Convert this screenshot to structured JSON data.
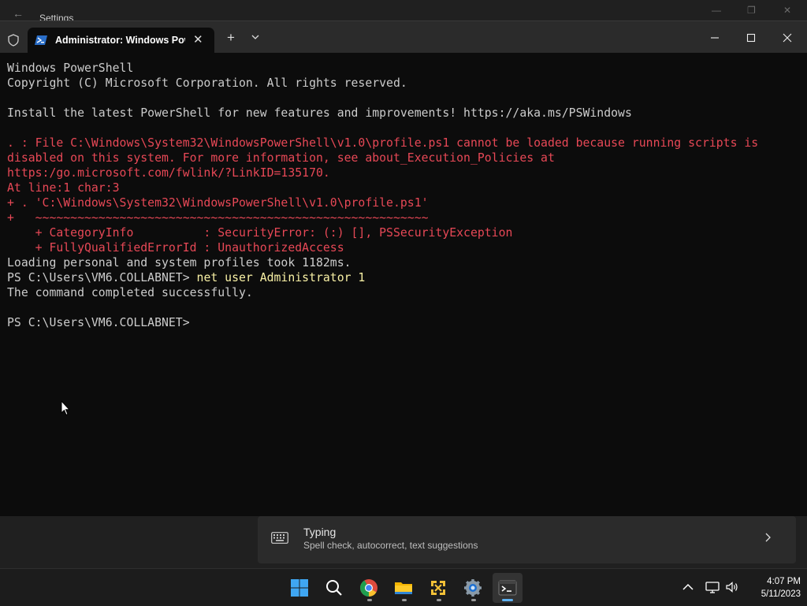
{
  "background_window": {
    "title": "Settings"
  },
  "terminal": {
    "tab_title": "Administrator: Windows PowerShell",
    "lines": [
      {
        "text": "Windows PowerShell",
        "color": "default"
      },
      {
        "text": "Copyright (C) Microsoft Corporation. All rights reserved.",
        "color": "default"
      },
      {
        "text": "",
        "color": "default"
      },
      {
        "text": "Install the latest PowerShell for new features and improvements! https://aka.ms/PSWindows",
        "color": "default"
      },
      {
        "text": "",
        "color": "default"
      },
      {
        "text": ". : File C:\\Windows\\System32\\WindowsPowerShell\\v1.0\\profile.ps1 cannot be loaded because running scripts is",
        "color": "red"
      },
      {
        "text": "disabled on this system. For more information, see about_Execution_Policies at",
        "color": "red"
      },
      {
        "text": "https:/go.microsoft.com/fwlink/?LinkID=135170.",
        "color": "red"
      },
      {
        "text": "At line:1 char:3",
        "color": "red"
      },
      {
        "text": "+ . 'C:\\Windows\\System32\\WindowsPowerShell\\v1.0\\profile.ps1'",
        "color": "red"
      },
      {
        "text": "+   ~~~~~~~~~~~~~~~~~~~~~~~~~~~~~~~~~~~~~~~~~~~~~~~~~~~~~~~~",
        "color": "red"
      },
      {
        "text": "    + CategoryInfo          : SecurityError: (:) [], PSSecurityException",
        "color": "red"
      },
      {
        "text": "    + FullyQualifiedErrorId : UnauthorizedAccess",
        "color": "red"
      },
      {
        "text": "Loading personal and system profiles took 1182ms.",
        "color": "default"
      },
      {
        "prompt": "PS C:\\Users\\VM6.COLLABNET> ",
        "command": "net user Administrator 1"
      },
      {
        "text": "The command completed successfully.",
        "color": "default"
      },
      {
        "text": "",
        "color": "default"
      },
      {
        "prompt": "PS C:\\Users\\VM6.COLLABNET>",
        "command": ""
      }
    ]
  },
  "suggestion": {
    "title": "Typing",
    "description": "Spell check, autocorrect, text suggestions",
    "icon": "keyboard-icon"
  },
  "taskbar": {
    "apps": [
      "start-icon",
      "search-icon",
      "chrome-icon",
      "file-explorer-icon",
      "app-icon",
      "settings-icon",
      "terminal-icon"
    ],
    "time": "4:07 PM",
    "date": "5/11/2023"
  },
  "colors": {
    "console_bg": "#0c0c0c",
    "console_text": "#cccccc",
    "error_red": "#e74856",
    "command_yellow": "#f9f1a5",
    "accent_blue": "#5fb2f2"
  }
}
